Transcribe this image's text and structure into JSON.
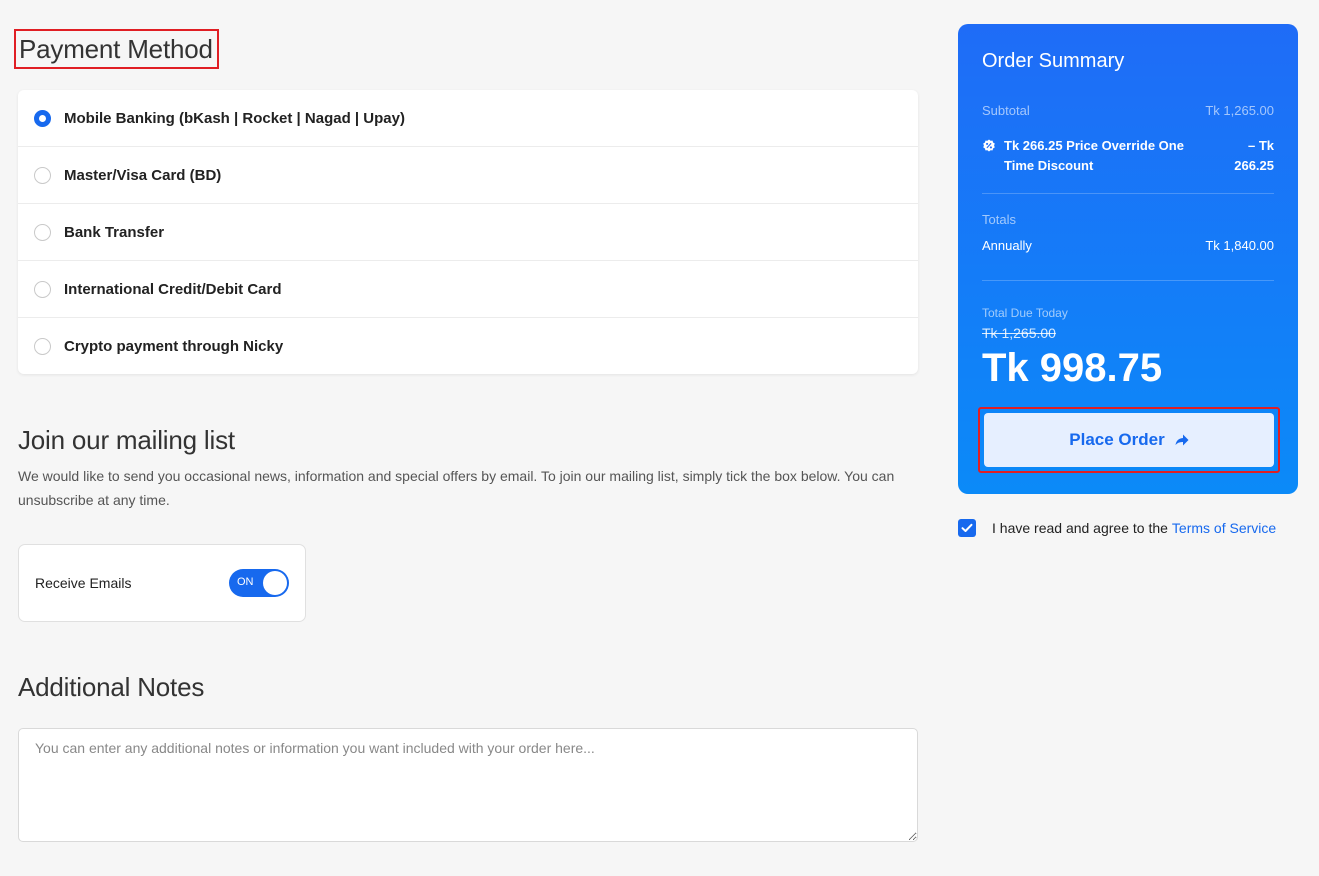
{
  "payment": {
    "title": "Payment Method",
    "options": [
      {
        "label": "Mobile Banking (bKash | Rocket | Nagad | Upay)",
        "selected": true
      },
      {
        "label": "Master/Visa Card (BD)",
        "selected": false
      },
      {
        "label": "Bank Transfer",
        "selected": false
      },
      {
        "label": "International Credit/Debit Card",
        "selected": false
      },
      {
        "label": "Crypto payment through Nicky",
        "selected": false
      }
    ]
  },
  "mailing": {
    "title": "Join our mailing list",
    "description": "We would like to send you occasional news, information and special offers by email. To join our mailing list, simply tick the box below. You can unsubscribe at any time.",
    "receive_label": "Receive Emails",
    "toggle_state": "ON"
  },
  "notes": {
    "title": "Additional Notes",
    "placeholder": "You can enter any additional notes or information you want included with your order here...",
    "value": ""
  },
  "summary": {
    "title": "Order Summary",
    "subtotal_label": "Subtotal",
    "subtotal_value": "Tk 1,265.00",
    "discount_label": "Tk 266.25 Price Override One Time Discount",
    "discount_value": "– Tk 266.25",
    "totals_label": "Totals",
    "cycle_label": "Annually",
    "cycle_value": "Tk 1,840.00",
    "due_label": "Total Due Today",
    "due_old": "Tk 1,265.00",
    "due_value": "Tk 998.75",
    "place_order_label": "Place Order"
  },
  "tos": {
    "text": "I have read and agree to the",
    "link": "Terms of Service",
    "checked": true
  },
  "colors": {
    "accent": "#1769ee",
    "highlight_border": "#e01e24"
  }
}
